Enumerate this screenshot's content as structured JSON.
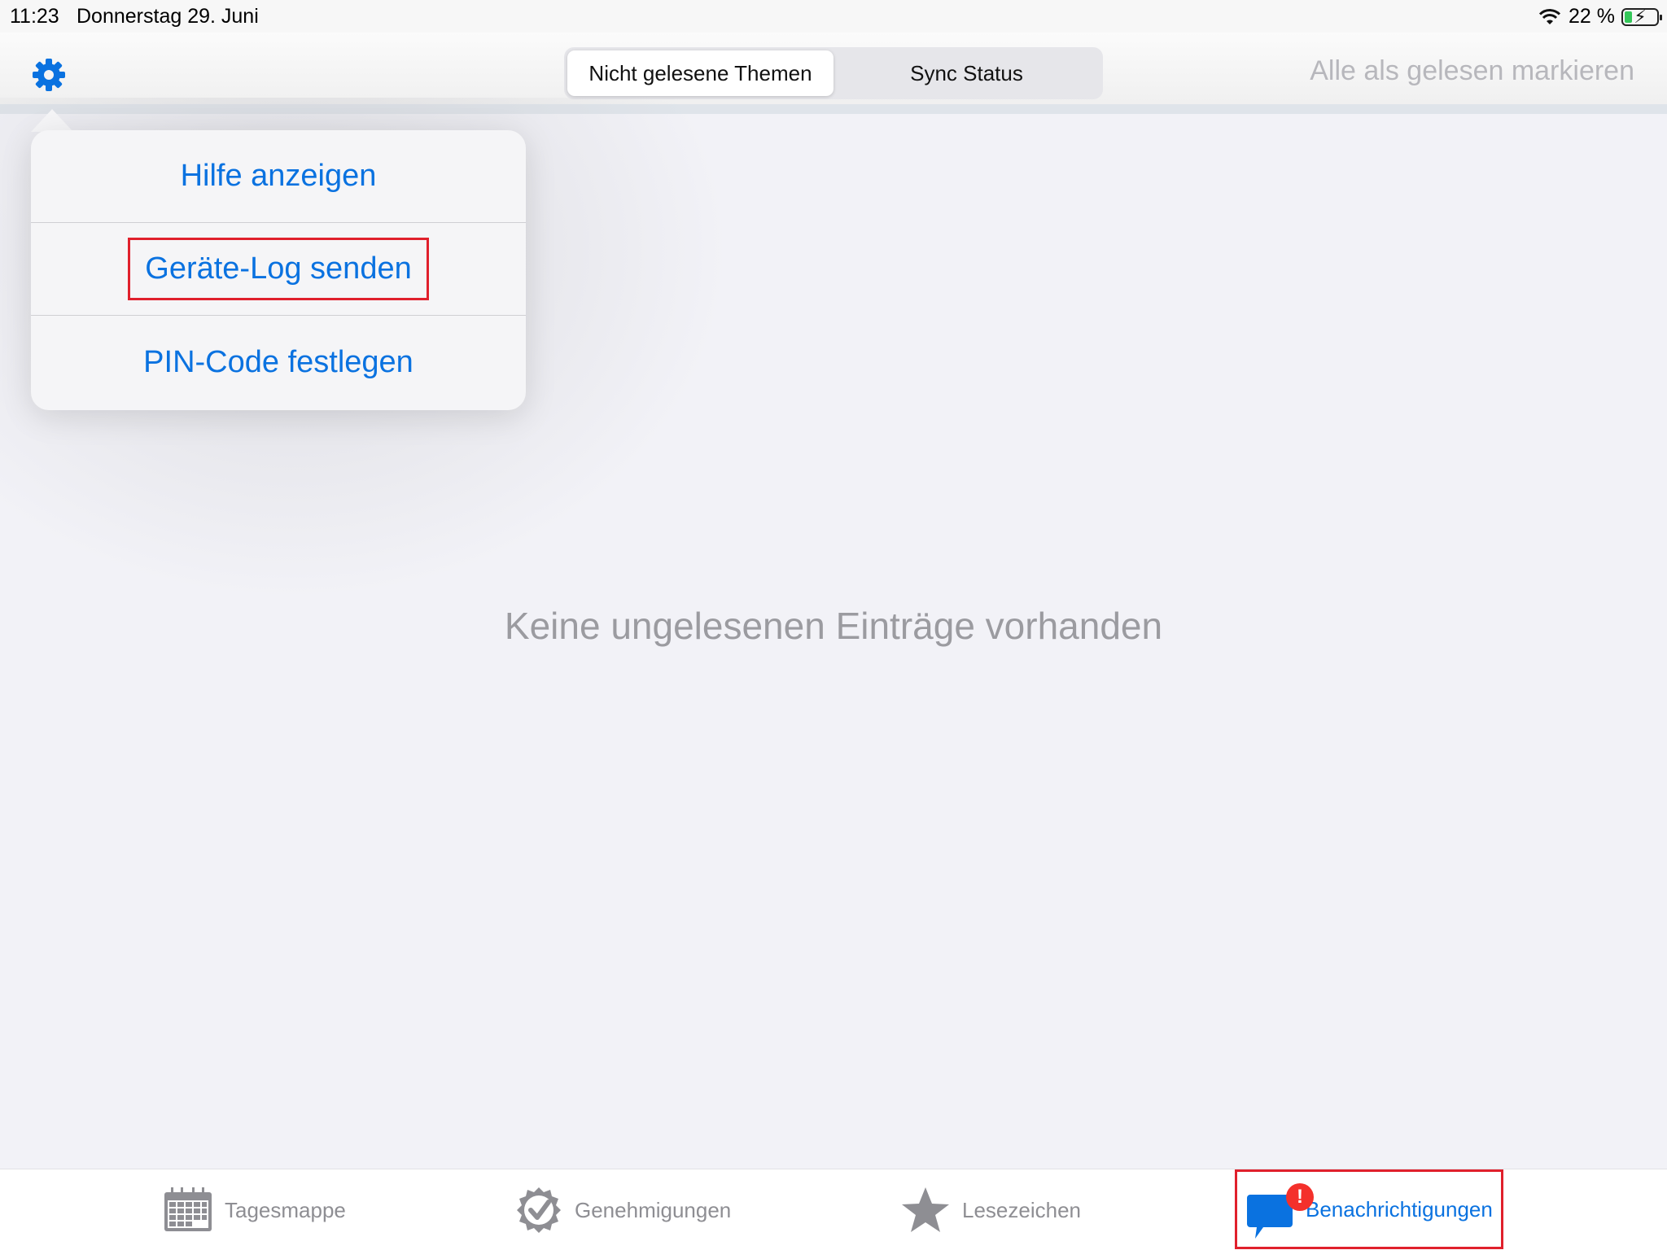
{
  "status_bar": {
    "time": "11:23",
    "date": "Donnerstag 29. Juni",
    "battery": "22 %",
    "battery_level": 0.22
  },
  "nav": {
    "segments": [
      "Nicht gelesene Themen",
      "Sync Status"
    ],
    "active_segment": 0,
    "mark_all_read": "Alle als gelesen markieren"
  },
  "popover": {
    "items": [
      "Hilfe anzeigen",
      "Geräte-Log senden",
      "PIN-Code festlegen"
    ],
    "highlighted_index": 1
  },
  "main": {
    "empty_message": "Keine ungelesenen Einträge vorhanden"
  },
  "tabbar": {
    "tabs": [
      {
        "label": "Tagesmappe",
        "icon": "calendar-icon"
      },
      {
        "label": "Genehmigungen",
        "icon": "badge-check-icon"
      },
      {
        "label": "Lesezeichen",
        "icon": "star-icon"
      },
      {
        "label": "Benachrichtigungen",
        "icon": "chat-bubble-icon",
        "badge": "!"
      }
    ],
    "active_tab": 3
  },
  "colors": {
    "accent": "#0a72e0",
    "highlight": "#e0202c",
    "badge": "#f4302b",
    "inactive": "#8e8e93"
  }
}
